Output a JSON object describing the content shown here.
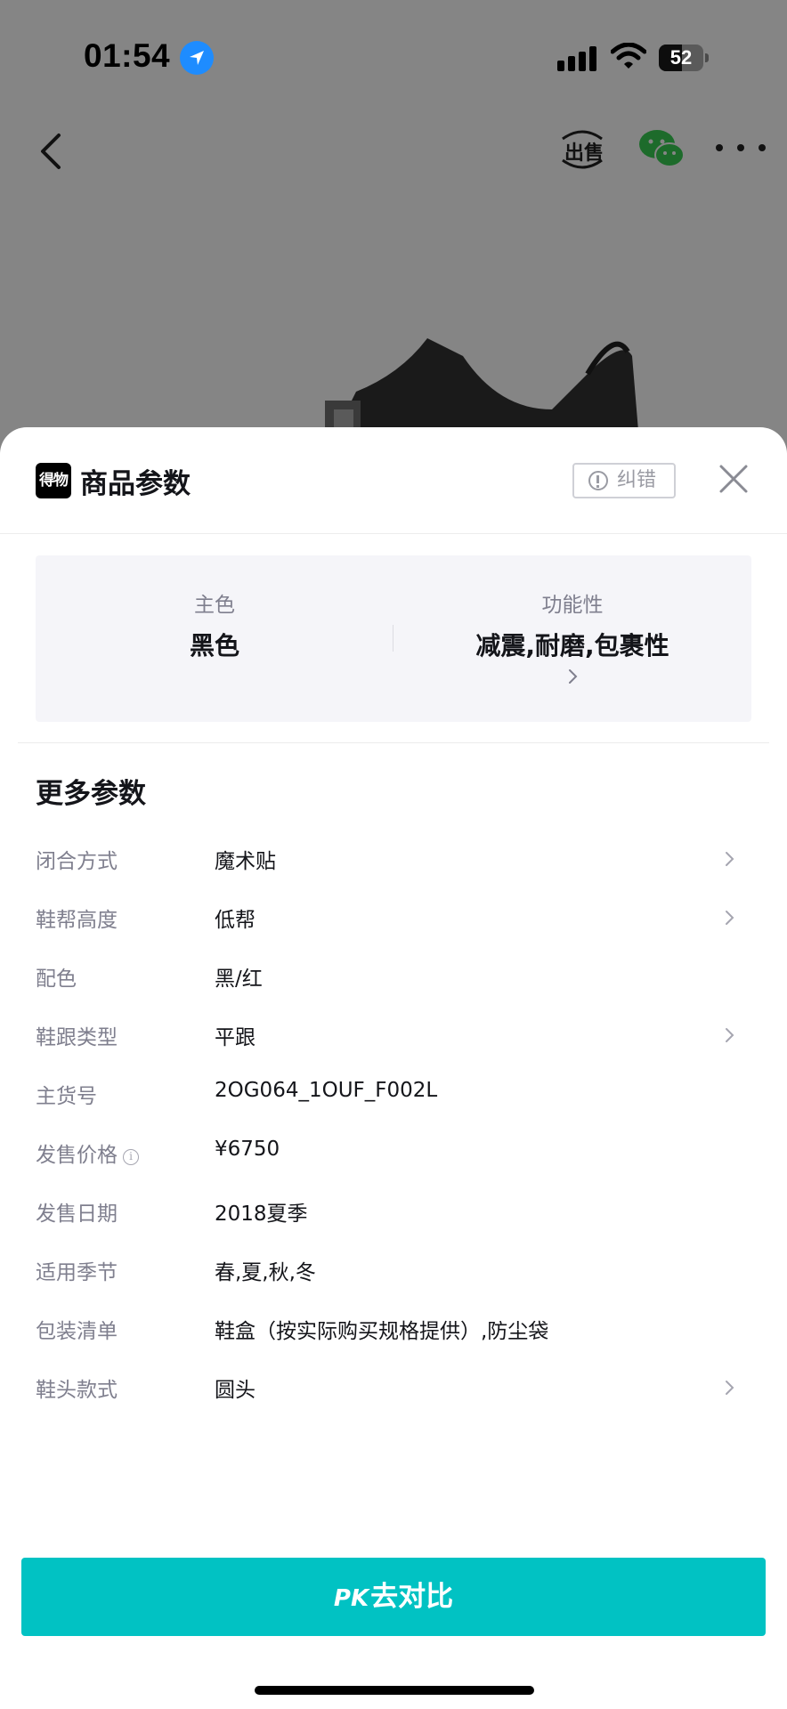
{
  "status_bar": {
    "time": "01:54",
    "battery_level": "52",
    "battery_fraction": 0.52,
    "icons": [
      "location-arrow-icon",
      "signal-icon",
      "wifi-icon",
      "battery-icon"
    ]
  },
  "nav": {
    "back_icon": "chevron-left-icon",
    "sell_label": "出售",
    "share_icon": "wechat-icon",
    "more_icon": "more-dots-icon"
  },
  "sheet": {
    "logo_text": "得物",
    "title": "商品参数",
    "report_label": "纠错",
    "close_icon": "close-icon",
    "key_params": [
      {
        "label": "主色",
        "value": "黑色"
      },
      {
        "label": "功能性",
        "value": "减震,耐磨,包裹性"
      }
    ],
    "more_title": "更多参数",
    "params": [
      {
        "label": "闭合方式",
        "value": "魔术贴",
        "has_arrow": true
      },
      {
        "label": "鞋帮高度",
        "value": "低帮",
        "has_arrow": true
      },
      {
        "label": "配色",
        "value": "黑/红",
        "has_arrow": false
      },
      {
        "label": "鞋跟类型",
        "value": "平跟",
        "has_arrow": true
      },
      {
        "label": "主货号",
        "value": "2OG064_1OUF_F002L",
        "has_arrow": false
      },
      {
        "label": "发售价格",
        "value": "¥6750",
        "has_arrow": false,
        "info": true
      },
      {
        "label": "发售日期",
        "value": "2018夏季",
        "has_arrow": false
      },
      {
        "label": "适用季节",
        "value": "春,夏,秋,冬",
        "has_arrow": false
      },
      {
        "label": "包装清单",
        "value": "鞋盒（按实际购买规格提供）,防尘袋",
        "has_arrow": false
      },
      {
        "label": "鞋头款式",
        "value": "圆头",
        "has_arrow": true
      }
    ],
    "pk_prefix": "PK",
    "pk_label": "去对比"
  },
  "colors": {
    "accent": "#01c2c3",
    "label_gray": "#7f7f8e",
    "text_dark": "#14151a",
    "overlay": "#858585"
  }
}
